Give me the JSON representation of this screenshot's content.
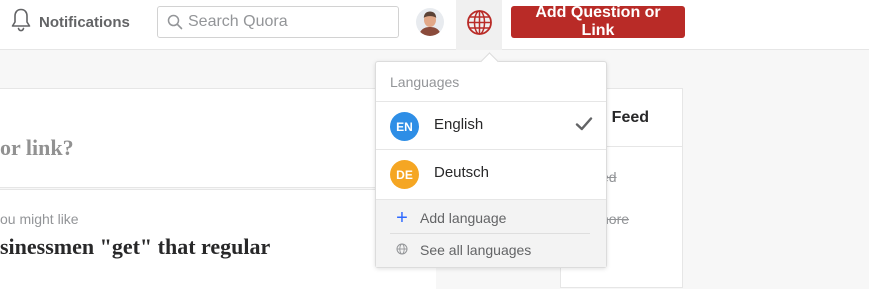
{
  "header": {
    "notifications_label": "Notifications",
    "search_placeholder": "Search Quora",
    "ask_button_label": "Add Question or Link"
  },
  "feed": {
    "prompt_fragment": "or link?",
    "suggestion_label": "ou might like",
    "question_fragment": "sinessmen \"get\" that regular"
  },
  "sidebar": {
    "title_fragment": "r Feed",
    "line1_fragment": "ed",
    "line2_fragment": "nore"
  },
  "language_menu": {
    "title": "Languages",
    "languages": [
      {
        "code": "EN",
        "name": "English",
        "selected": true,
        "color": "#2e8ee6"
      },
      {
        "code": "DE",
        "name": "Deutsch",
        "selected": false,
        "color": "#f5a623"
      }
    ],
    "add_language_label": "Add language",
    "see_all_label": "See all languages"
  },
  "colors": {
    "brand_red": "#b92b27",
    "accent_blue": "#2e69ff"
  },
  "icons": [
    "bell-icon",
    "search-icon",
    "avatar",
    "globe-icon",
    "check-icon",
    "plus-icon",
    "small-globe-icon"
  ]
}
